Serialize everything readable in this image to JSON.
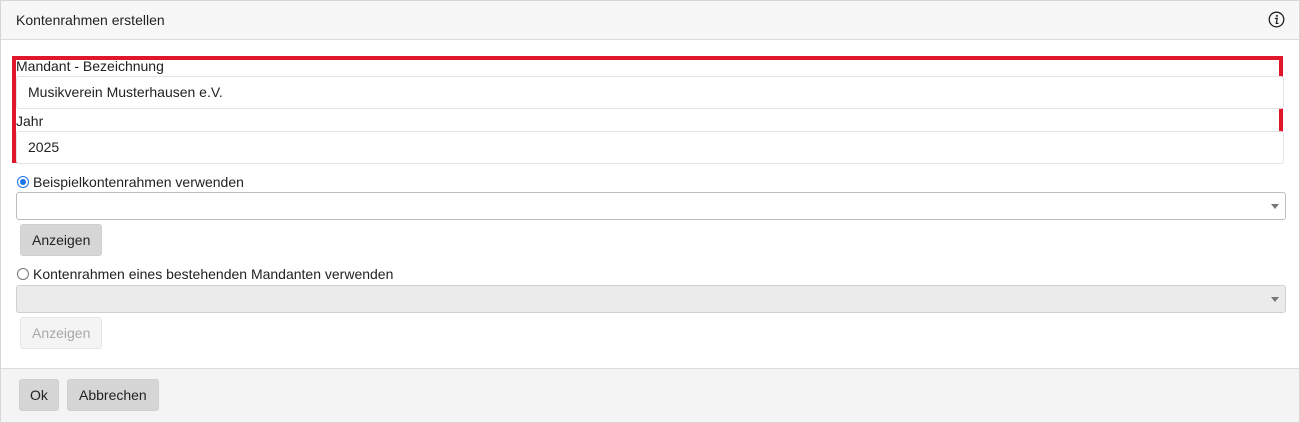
{
  "dialog": {
    "title": "Kontenrahmen erstellen",
    "info_icon": "info-icon"
  },
  "form": {
    "mandant_label": "Mandant - Bezeichnung",
    "mandant_value": "Musikverein Musterhausen e.V.",
    "jahr_label": "Jahr",
    "jahr_value": "2025",
    "option_beispiel_label": "Beispielkontenrahmen verwenden",
    "option_beispiel_selected": true,
    "beispiel_select_value": "",
    "beispiel_show_label": "Anzeigen",
    "option_bestehend_label": "Kontenrahmen eines bestehenden Mandanten verwenden",
    "option_bestehend_selected": false,
    "bestehend_select_value": "",
    "bestehend_show_label": "Anzeigen"
  },
  "footer": {
    "ok_label": "Ok",
    "cancel_label": "Abbrechen"
  },
  "colors": {
    "highlight": "#e0162b",
    "radio_accent": "#1a73e8"
  }
}
